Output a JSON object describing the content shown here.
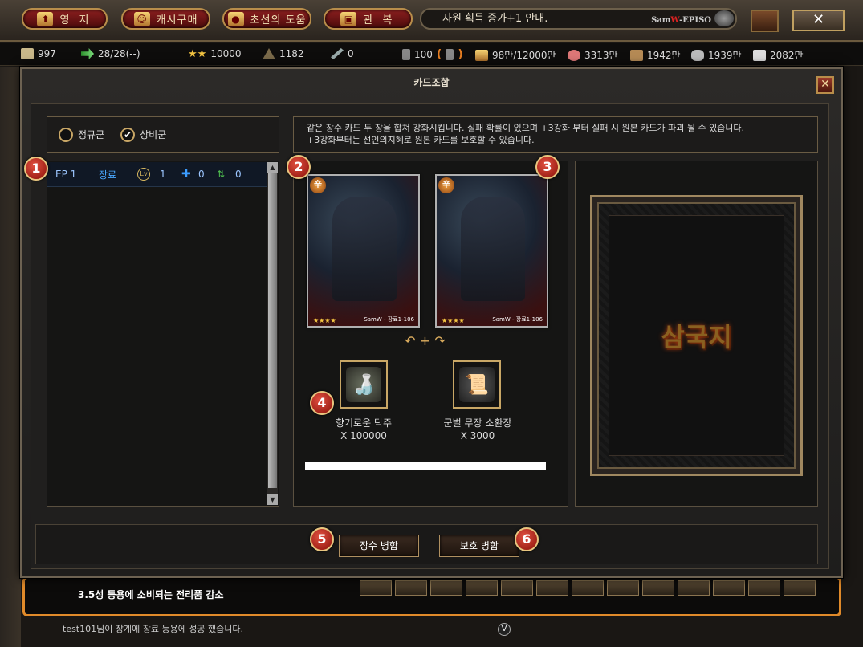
{
  "topbar": {
    "nav": [
      {
        "label": "영 지",
        "icon": "up-arrow-icon"
      },
      {
        "label": "캐시구매",
        "icon": "merchant-icon"
      },
      {
        "label": "초선의 도움",
        "icon": "coins-icon"
      },
      {
        "label": "관 복",
        "icon": "treasure-chest-icon"
      }
    ],
    "notice": "자원 획득 증가+1 안내.",
    "notice_logo_pre": "Sam",
    "notice_logo_w": "W",
    "notice_logo_post": "-EPISO",
    "close": "✕"
  },
  "resources": [
    {
      "icon": "scroll-icon",
      "value": "997"
    },
    {
      "icon": "arrow-icon",
      "value": "28/28(--)"
    },
    {
      "icon": "stars-icon",
      "value": "10000"
    },
    {
      "icon": "soldier-icon",
      "value": "1182"
    },
    {
      "icon": "sword-icon",
      "value": "0"
    },
    {
      "icon": "person-icon",
      "value": "100"
    },
    {
      "icon": "gold-icon",
      "value": "98만/12000만"
    },
    {
      "icon": "meat-icon",
      "value": "3313만"
    },
    {
      "icon": "wood-icon",
      "value": "1942만"
    },
    {
      "icon": "iron-icon",
      "value": "1939만"
    },
    {
      "icon": "stone-icon",
      "value": "2082만"
    }
  ],
  "window": {
    "title": "카드조합",
    "close": "✕",
    "tabs": [
      {
        "label": "정규군",
        "checked": false
      },
      {
        "label": "상비군",
        "checked": true
      }
    ],
    "list": [
      {
        "ep": "EP 1",
        "name": "장료",
        "level": "1",
        "plus": "0",
        "swap": "0"
      }
    ],
    "description_line1": "같은 장수 카드 두 장을 합쳐 강화시킵니다. 실패 확률이 있으며 +3강화 부터 실패 시 원본 카드가 파괴 될 수 있습니다.",
    "description_line2": "+3강화부터는 선인의지혜로 원본 카드를 보호할 수 있습니다.",
    "cards": [
      {
        "emblem": "辛",
        "stars": "★★★★",
        "tag": "SamW - 장료1-106"
      },
      {
        "emblem": "辛",
        "stars": "★★★★",
        "tag": "SamW - 장료1-106"
      }
    ],
    "items": [
      {
        "name": "향기로운 탁주",
        "qty": "X 100000"
      },
      {
        "name": "군벌 무장 소환장",
        "qty": "X 3000"
      }
    ],
    "progress": 1.0,
    "card_back_logo": "삼국지",
    "buttons": {
      "general_merge": "장수 병합",
      "protect_merge": "보호 병합"
    },
    "badges": [
      "1",
      "2",
      "3",
      "4",
      "5",
      "6"
    ]
  },
  "background": {
    "message": "3.5성 등용에 소비되는 전리품 감소",
    "chat": "test101님이 장계에 장료 등용에 성공 했습니다.",
    "chat_button": "V"
  },
  "colors": {
    "accent_red": "#8c1f1f",
    "gold_border": "#c9a766",
    "name_blue": "#4aa8ff"
  }
}
